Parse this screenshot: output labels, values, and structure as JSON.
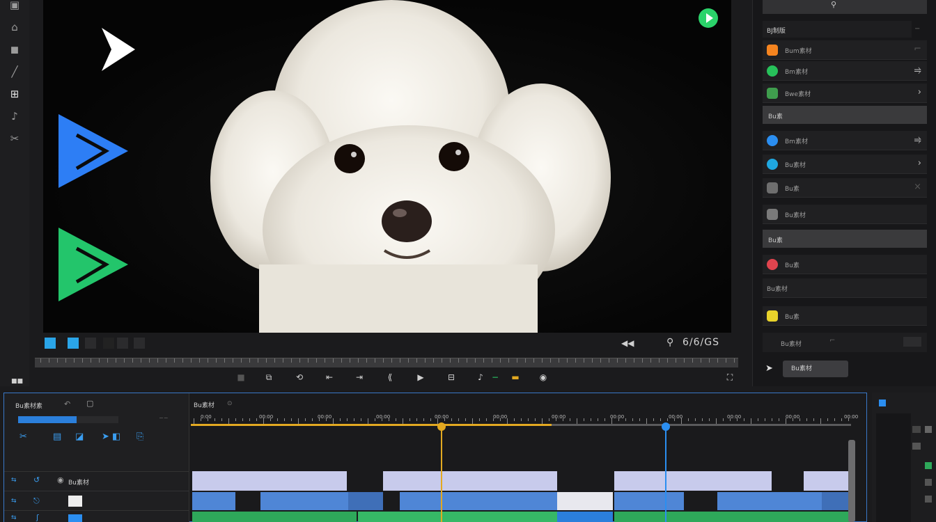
{
  "left_toolbar": {
    "tools": [
      "select-icon",
      "crop-icon",
      "layers-icon",
      "pen-icon",
      "text-icon",
      "audio-icon",
      "razor-icon"
    ]
  },
  "preview": {
    "timecode": "6/6/GS"
  },
  "right_panel": {
    "header_label": "",
    "section1": "BJ制版",
    "items_a": [
      {
        "label": "Bum素材",
        "color": "#f5841f"
      },
      {
        "label": "Bm素材",
        "color": "#27c15a"
      },
      {
        "label": "Bwe素材",
        "color": "#3f9d4d"
      }
    ],
    "section2": "Bu素",
    "items_b": [
      {
        "label": "Bm素材",
        "color": "#2b8ef0"
      },
      {
        "label": "Bu素材",
        "color": "#1fa7e0"
      },
      {
        "label": "Bu素",
        "color": "#6e6e6e"
      },
      {
        "label": "Bu素材",
        "color": "#7a7a7a"
      }
    ],
    "section3": "Bu素",
    "items_c": [
      {
        "label": "Bu素",
        "color": "#e0444e"
      },
      {
        "label": "Bu素材",
        "color": "#333"
      },
      {
        "label": "Bu素",
        "color": "#e8d32b"
      }
    ],
    "bottom_label": "Bu素材",
    "button_label": "Bu素材"
  },
  "timeline": {
    "header_title": "Bu素材素",
    "main_title": "Bu素材",
    "ruler_labels": [
      "0:00",
      "00:00",
      "00:00",
      "00:00",
      "00:00",
      "00:00",
      "00:00",
      "00:00",
      "00:00",
      "00:00",
      "00:00",
      "00:00"
    ],
    "track_labels": [
      "Bu素材",
      "",
      ""
    ]
  },
  "colors": {
    "accent_blue": "#3a79c9",
    "playhead_yellow": "#e3a921",
    "playhead_blue": "#2b8ef0",
    "video_clip": "#4f86d6",
    "audio_clip": "#2ea85a",
    "title_clip": "#c8cbec"
  }
}
